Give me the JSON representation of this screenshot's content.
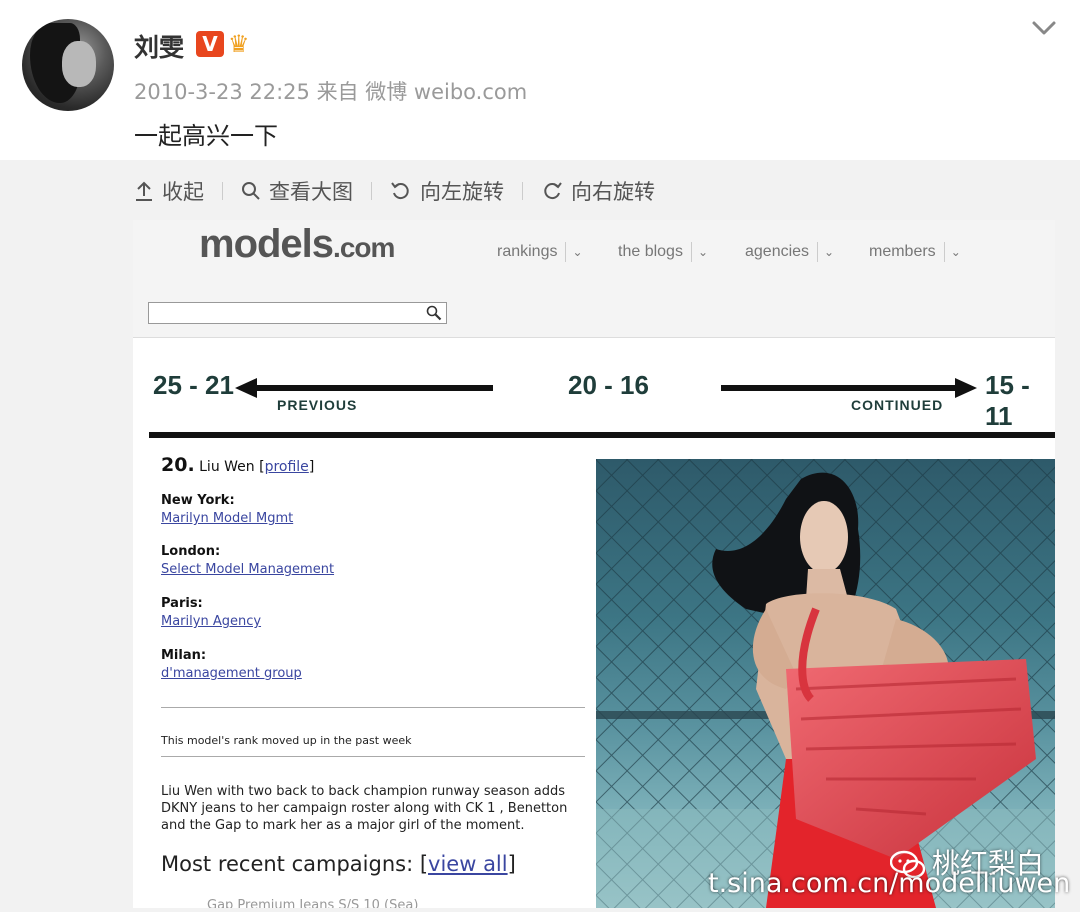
{
  "post": {
    "username": "刘雯",
    "badge_v": "V",
    "timestamp": "2010-3-23 22:25",
    "source_prefix": "来自",
    "source": "微博 weibo.com",
    "text": "一起高兴一下"
  },
  "toolbar": {
    "collapse": "收起",
    "view_large": "查看大图",
    "rotate_left": "向左旋转",
    "rotate_right": "向右旋转"
  },
  "models_site": {
    "logo_main": "models",
    "logo_tld": ".com",
    "nav": [
      "rankings",
      "the blogs",
      "agencies",
      "members"
    ],
    "ranks": {
      "prev_range": "25 - 21",
      "prev_label": "PREVIOUS",
      "current_range": "20 - 16",
      "next_range": "15 - 11",
      "next_label": "CONTINUED"
    },
    "model": {
      "rank": "20.",
      "name": "Liu Wen",
      "profile_link": "profile",
      "agencies": [
        {
          "city": "New York:",
          "agency": "Marilyn Model Mgmt"
        },
        {
          "city": "London:",
          "agency": "Select Model Management"
        },
        {
          "city": "Paris:",
          "agency": "Marilyn Agency"
        },
        {
          "city": "Milan:",
          "agency": "d'management group"
        }
      ],
      "rank_note": "This model's rank moved up in the past week",
      "bio": "Liu Wen with two back to back champion runway season adds DKNY jeans to her campaign roster along with CK 1 , Benetton and the Gap to mark her as a major girl of the moment.",
      "campaigns_title": "Most recent campaigns: [",
      "campaigns_link": "view all",
      "campaigns_close": "]",
      "campaign_item": "Gap Premium Jeans S/S 10 (Sea)"
    }
  },
  "watermark": {
    "account": "桃红梨白",
    "url": "t.sina.com.cn/modelliuwen"
  },
  "colors": {
    "accent_link": "#3a46a0",
    "rank_text": "#1f3d3a",
    "badge_v": "#e8461e"
  }
}
